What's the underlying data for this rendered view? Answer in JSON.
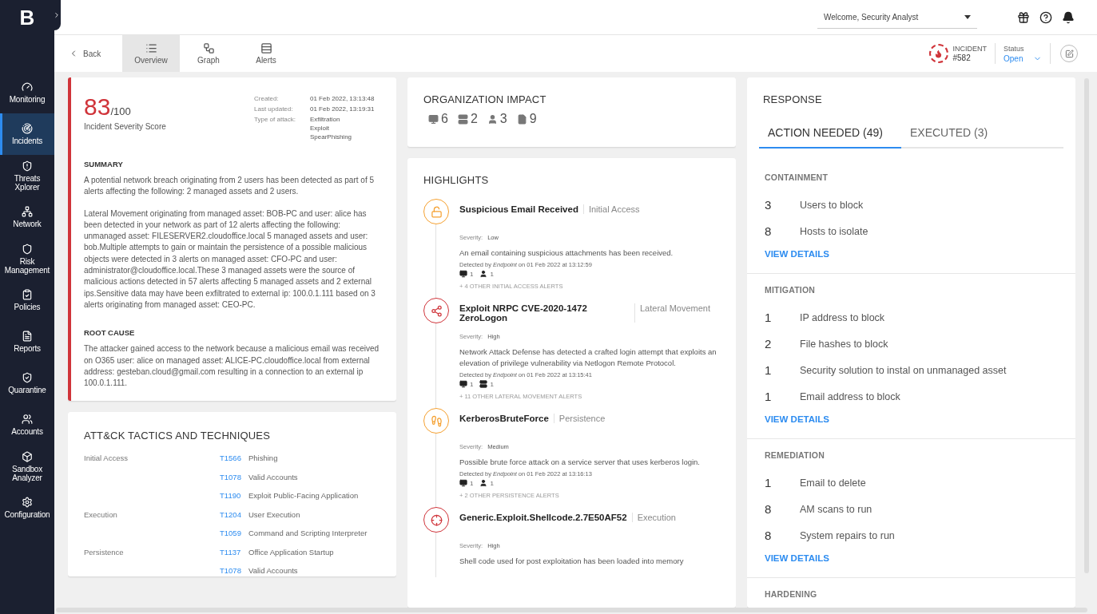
{
  "sidebar": {
    "logo": "B",
    "items": [
      {
        "label": "Monitoring",
        "selected": false
      },
      {
        "label": "Incidents",
        "selected": true
      },
      {
        "label": "Threats Xplorer",
        "selected": false
      },
      {
        "label": "Network",
        "selected": false
      },
      {
        "label": "Risk Management",
        "selected": false
      },
      {
        "label": "Policies",
        "selected": false
      },
      {
        "label": "Reports",
        "selected": false
      },
      {
        "label": "Quarantine",
        "selected": false
      },
      {
        "label": "Accounts",
        "selected": false
      },
      {
        "label": "Sandbox Analyzer",
        "selected": false
      },
      {
        "label": "Configuration",
        "selected": false
      }
    ]
  },
  "header": {
    "welcome": "Welcome, Security Analyst"
  },
  "toolbar": {
    "back": "Back",
    "tabs": [
      {
        "label": "Overview",
        "selected": true
      },
      {
        "label": "Graph",
        "selected": false
      },
      {
        "label": "Alerts",
        "selected": false
      }
    ],
    "incident": {
      "label": "INCIDENT",
      "number": "#582"
    },
    "status": {
      "label": "Status",
      "value": "Open"
    }
  },
  "severity": {
    "score": "83",
    "max": "/100",
    "label": "Incident Severity Score",
    "meta": [
      {
        "label": "Created:",
        "values": [
          "01 Feb 2022, 13:13:48"
        ]
      },
      {
        "label": "Last updated:",
        "values": [
          "01 Feb 2022, 13:19:31"
        ]
      },
      {
        "label": "Type of attack:",
        "values": [
          "Exfiltration",
          "Exploit",
          "SpearPhishing"
        ]
      }
    ]
  },
  "summary": {
    "title": "SUMMARY",
    "paragraphs": [
      "A potential network breach originating from 2 users has been detected as part of 5 alerts affecting the following: 2 managed assets and 2 users.",
      "Lateral Movement originating from managed asset: BOB-PC and user: alice has been detected in your network as part of 12 alerts affecting the following: unmanaged asset: FILESERVER2.cloudoffice.local 5 managed assets and user: bob.Multiple attempts to gain or maintain the persistence of a possible malicious objects were detected in 3 alerts on managed asset: CFO-PC and user: administrator@cloudoffice.local.These 3 managed assets were the source of malicious actions detected in 57 alerts affecting 5 managed assets and 2 external ips.Sensitive data may have been exfiltrated to external ip: 100.0.1.111 based on 3 alerts originating from managed asset: CEO-PC."
    ]
  },
  "root_cause": {
    "title": "ROOT CAUSE",
    "text": "The attacker gained access to the network because a malicious email was received on O365 user: alice on managed asset: ALICE-PC.cloudoffice.local from external address: gesteban.cloud@gmail.com resulting in a connection to an external ip 100.0.1.111."
  },
  "tactics": {
    "title": "ATT&CK TACTICS AND TECHNIQUES",
    "rows": [
      {
        "tactic": "Initial Access",
        "id": "T1566",
        "technique": "Phishing"
      },
      {
        "id": "T1078",
        "technique": "Valid Accounts"
      },
      {
        "id": "T1190",
        "technique": "Exploit Public-Facing Application"
      },
      {
        "tactic": "Execution",
        "id": "T1204",
        "technique": "User Execution"
      },
      {
        "id": "T1059",
        "technique": "Command and Scripting Interpreter"
      },
      {
        "tactic": "Persistence",
        "id": "T1137",
        "technique": "Office Application Startup"
      },
      {
        "id": "T1078",
        "technique": "Valid Accounts"
      }
    ]
  },
  "impact": {
    "title": "ORGANIZATION IMPACT",
    "assets": [
      {
        "kind": "computer",
        "count": "6"
      },
      {
        "kind": "server",
        "count": "2"
      },
      {
        "kind": "user",
        "count": "3"
      },
      {
        "kind": "file",
        "count": "9"
      }
    ]
  },
  "highlights": {
    "title": "HIGHLIGHTS",
    "items": [
      {
        "kind": "lock",
        "color": "#f5a030",
        "title": "Suspicious Email Received",
        "category": "Initial Access",
        "severity_label": "Severity:",
        "severity": "Low",
        "description": "An email containing suspicious attachments has been received.",
        "detected": "Detected by *Endpoint* on 01 Feb 2022 at 13:12:59",
        "assets": [
          {
            "kind": "computer",
            "count": "1"
          },
          {
            "kind": "user",
            "count": "1"
          }
        ],
        "more": "+ 4 OTHER INITIAL ACCESS ALERTS"
      },
      {
        "kind": "network",
        "color": "#d0343a",
        "title": "Exploit NRPC CVE-2020-1472 ZeroLogon",
        "category": "Lateral Movement",
        "severity_label": "Severity:",
        "severity": "High",
        "description": "Network Attack Defense has detected a crafted login attempt that exploits an elevation of privilege vulnerability via Netlogon Remote Protocol.",
        "detected": "Detected by *Endpoint* on 01 Feb 2022 at 13:15:41",
        "assets": [
          {
            "kind": "computer",
            "count": "1"
          },
          {
            "kind": "server",
            "count": "1"
          }
        ],
        "more": "+ 11 OTHER LATERAL MOVEMENT ALERTS"
      },
      {
        "kind": "footprints",
        "color": "#f5a030",
        "title": "KerberosBruteForce",
        "category": "Persistence",
        "severity_label": "Severity:",
        "severity": "Medium",
        "description": "Possible brute force attack on a service server that uses kerberos login.",
        "detected": "Detected by *Endpoint* on 01 Feb 2022 at 13:16:13",
        "assets": [
          {
            "kind": "computer",
            "count": "1"
          },
          {
            "kind": "user",
            "count": "1"
          }
        ],
        "more": "+ 2 OTHER PERSISTENCE ALERTS"
      },
      {
        "kind": "target",
        "color": "#d0343a",
        "title": "Generic.Exploit.Shellcode.2.7E50AF52",
        "category": "Execution",
        "severity_label": "Severity:",
        "severity": "High",
        "description": "Shell code used for post exploitation has been loaded into memory"
      }
    ]
  },
  "response": {
    "title": "RESPONSE",
    "tabs": [
      {
        "label": "ACTION NEEDED (49)",
        "selected": true
      },
      {
        "label": "EXECUTED (3)",
        "selected": false
      }
    ],
    "sections": [
      {
        "title": "CONTAINMENT",
        "rows": [
          {
            "count": "3",
            "label": "Users to block"
          },
          {
            "count": "8",
            "label": "Hosts to isolate"
          }
        ],
        "link": "VIEW DETAILS"
      },
      {
        "title": "MITIGATION",
        "rows": [
          {
            "count": "1",
            "label": "IP address to block"
          },
          {
            "count": "2",
            "label": "File hashes to block"
          },
          {
            "count": "1",
            "label": "Security solution to instal on unmanaged asset"
          },
          {
            "count": "1",
            "label": "Email address to block"
          }
        ],
        "link": "VIEW DETAILS"
      },
      {
        "title": "REMEDIATION",
        "rows": [
          {
            "count": "1",
            "label": "Email to delete"
          },
          {
            "count": "8",
            "label": "AM scans to run"
          },
          {
            "count": "8",
            "label": "System repairs to run"
          }
        ],
        "link": "VIEW DETAILS"
      },
      {
        "title": "HARDENING"
      }
    ]
  }
}
